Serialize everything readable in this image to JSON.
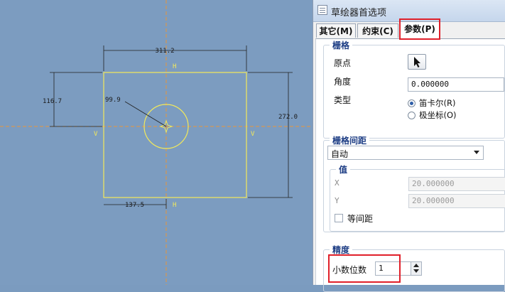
{
  "sketch": {
    "dims": {
      "width_top": "311.2",
      "height_left": "116.7",
      "height_right": "272.0",
      "diameter": "99.9",
      "bottom_offset": "137.5"
    },
    "constraint_labels": {
      "top": "H",
      "bottom": "H",
      "left": "V",
      "right": "V"
    }
  },
  "dialog": {
    "title": "草绘器首选项",
    "tabs": [
      "其它(M)",
      "约束(C)",
      "参数(P)"
    ],
    "grid": {
      "title": "栅格",
      "origin_label": "原点",
      "angle_label": "角度",
      "angle_value": "0.000000",
      "type_label": "类型",
      "type_options": [
        "笛卡尔(R)",
        "极坐标(O)"
      ],
      "type_selected": "笛卡尔(R)"
    },
    "spacing": {
      "title": "栅格间距",
      "mode": "自动",
      "value_title": "值",
      "x_label": "X",
      "x_value": "20.000000",
      "y_label": "Y",
      "y_value": "20.000000",
      "equal_label": "等间距"
    },
    "precision": {
      "title": "精度",
      "decimal_label": "小数位数",
      "decimal_value": "1"
    },
    "colors": {
      "highlight_box": "#e0202a",
      "sketch_line": "#f3e95a",
      "centerline": "#e8963a",
      "background": "#7c9cc0"
    }
  }
}
